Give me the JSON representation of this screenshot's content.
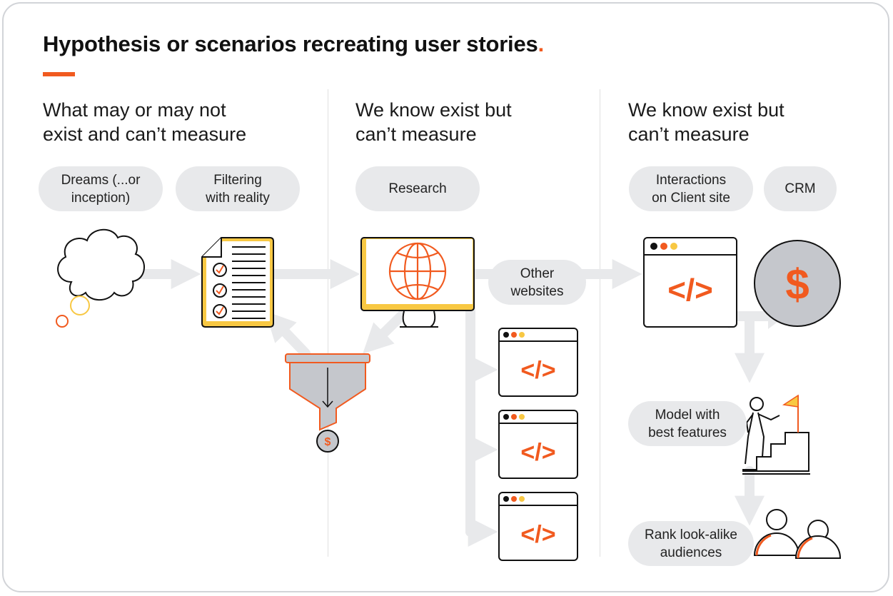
{
  "title": {
    "text": "Hypothesis or scenarios recreating user stories",
    "accent_dot": "."
  },
  "colors": {
    "accent": "#f15a1f",
    "yellow": "#f8c843",
    "arrow": "#e8e9eb",
    "pill": "#e8e9eb",
    "coin": "#c5c7cc"
  },
  "columns": [
    {
      "heading_line1": "What may or may not",
      "heading_line2": "exist and can’t measure",
      "pills": [
        {
          "line1": "Dreams (...or",
          "line2": "inception)"
        },
        {
          "line1": "Filtering",
          "line2": "with reality"
        }
      ]
    },
    {
      "heading_line1": "We know exist but",
      "heading_line2": "can’t measure",
      "pills": [
        {
          "line1": "Research",
          "line2": ""
        }
      ]
    },
    {
      "heading_line1": "We know exist but",
      "heading_line2": "can’t measure",
      "pills": [
        {
          "line1": "Interactions",
          "line2": "on Client site"
        },
        {
          "line1": "CRM",
          "line2": ""
        }
      ]
    }
  ],
  "labels": {
    "other_websites": {
      "line1": "Other",
      "line2": "websites"
    },
    "model": {
      "line1": "Model with",
      "line2": "best features"
    },
    "rank": {
      "line1": "Rank look-alike",
      "line2": "audiences"
    }
  },
  "icons": {
    "code": "</>",
    "dollar": "$"
  }
}
